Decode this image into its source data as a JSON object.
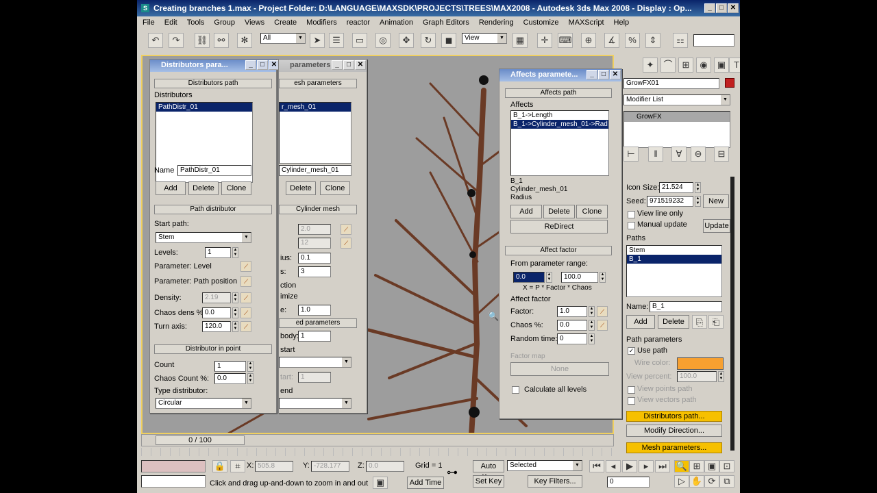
{
  "app": {
    "title": "Creating branches 1.max    - Project Folder: D:\\LANGUAGE\\MAXSDK\\PROJECTS\\TREES\\MAX2008    - Autodesk 3ds Max 2008    - Display : Op..."
  },
  "menu": [
    "File",
    "Edit",
    "Tools",
    "Group",
    "Views",
    "Create",
    "Modifiers",
    "reactor",
    "Animation",
    "Graph Editors",
    "Rendering",
    "Customize",
    "MAXScript",
    "Help"
  ],
  "toolbar": {
    "selection_filter": "All",
    "ref_coord": "View"
  },
  "dist_panel": {
    "title": "Distributors para...",
    "rollup_path": "Distributors path",
    "group_label": "Distributors",
    "list": [
      "PathDistr_01"
    ],
    "name_label": "Name",
    "name_value": "PathDistr_01",
    "add": "Add",
    "delete": "Delete",
    "clone": "Clone",
    "rollup_path_dist": "Path distributor",
    "start_path_label": "Start path:",
    "start_path_value": "Stem",
    "levels_label": "Levels:",
    "levels_value": "1",
    "param_level": "Parameter: Level",
    "param_path_pos": "Parameter: Path position",
    "density_label": "Density:",
    "density_value": "2.19",
    "chaos_dens_label": "Chaos dens %:",
    "chaos_dens_value": "0.0",
    "turn_axis_label": "Turn axis:",
    "turn_axis_value": "120.0",
    "rollup_point": "Distributor in point",
    "count_label": "Count",
    "count_value": "1",
    "chaos_count_label": "Chaos Count %:",
    "chaos_count_value": "0.0",
    "type_dist_label": "Type distributor:",
    "type_dist_value": "Circular"
  },
  "mesh_panel": {
    "title": "parameters",
    "rollup": "esh parameters",
    "list": [
      "r_mesh_01"
    ],
    "name_value": "Cylinder_mesh_01",
    "delete": "Delete",
    "clone": "Clone",
    "rollup_cyl": "Cylinder mesh",
    "v1": "2.0",
    "v2": "12",
    "lbl_radius": "ius:",
    "v_radius": "0.1",
    "lbl_s": "s:",
    "v_s": "3",
    "lbl_ction": "ction",
    "lbl_mize": "imize",
    "lbl_e": "e:",
    "v_e": "1.0",
    "rollup_ed": "ed parameters",
    "lbl_body": "body:",
    "v_body": "1",
    "lbl_start": "start",
    "lbl_tart": "tart:",
    "v_tart": "1",
    "lbl_end": "end"
  },
  "affects_panel": {
    "title": "Affects paramete...",
    "rollup_path": "Affects path",
    "group_label": "Affects",
    "list": [
      "B_1->Length",
      "B_1->Cylinder_mesh_01->Rad"
    ],
    "info_l1": "B_1",
    "info_l2": "Cylinder_mesh_01",
    "info_l3": "Radius",
    "add": "Add",
    "delete": "Delete",
    "clone": "Clone",
    "redirect": "ReDirect",
    "rollup_factor": "Affect factor",
    "from_range_label": "From parameter range:",
    "range_from": "0.0",
    "range_to": "100.0",
    "formula": "X = P * Factor * Chaos",
    "affect_factor_group": "Affect factor",
    "factor_label": "Factor:",
    "factor_value": "1.0",
    "chaos_label": "Chaos %:",
    "chaos_value": "0.0",
    "random_label": "Random time:",
    "random_value": "0",
    "factor_map_label": "Factor map",
    "none_btn": "None",
    "calc_label": "Calculate all levels"
  },
  "command_panel": {
    "obj_name": "GrowFX01",
    "modifier_list": "Modifier List",
    "stack_item": "GrowFX",
    "icon_size_label": "Icon Size:",
    "icon_size_value": "21.524",
    "seed_label": "Seed:",
    "seed_value": "971519232",
    "new_btn": "New",
    "view_line": "View line only",
    "manual_update": "Manual update",
    "update_btn": "Update",
    "paths_label": "Paths",
    "paths": [
      "Stem",
      "B_1"
    ],
    "name_label": "Name:",
    "name_value": "B_1",
    "add": "Add",
    "delete": "Delete",
    "path_params": "Path parameters",
    "use_path": "Use path",
    "wire_color": "Wire color:",
    "view_percent": "View percent:",
    "view_percent_value": "100.0",
    "view_points": "View points path",
    "view_vectors": "View vectors path",
    "dist_path_btn": "Distributors path...",
    "modify_dir_btn": "Modify Direction...",
    "mesh_params_btn": "Mesh parameters..."
  },
  "timeline": {
    "frame": "0 / 100"
  },
  "status": {
    "x_label": "X:",
    "x_value": "505.8",
    "y_label": "Y:",
    "y_value": "-728.177",
    "z_label": "Z:",
    "z_value": "0.0",
    "grid": "Grid = 1",
    "auto_key": "Auto Key",
    "set_key": "Set Key",
    "selected": "Selected",
    "key_filters": "Key Filters...",
    "add_time": "Add Time",
    "prompt": "Click and drag up-and-down to zoom in and out",
    "frame_field": "0"
  },
  "colors": {
    "wire": "#f7a030",
    "swatch": "#c02020",
    "selection": "#0a246a"
  }
}
